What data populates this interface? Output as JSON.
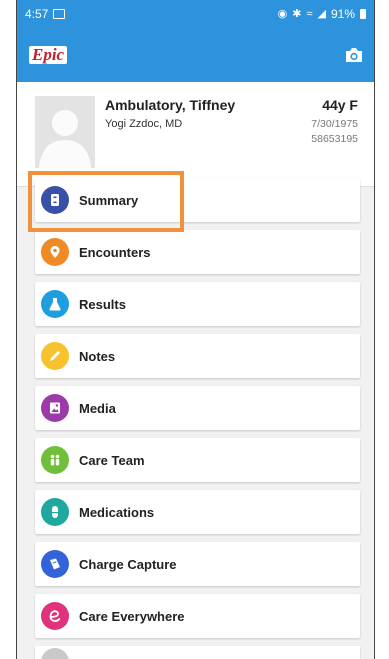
{
  "status_bar": {
    "time": "4:57",
    "battery": "91%"
  },
  "app": {
    "logo": "Epic"
  },
  "patient": {
    "name": "Ambulatory, Tiffney",
    "provider": "Yogi Zzdoc, MD",
    "age_sex": "44y F",
    "dob": "7/30/1975",
    "mrn": "58653195"
  },
  "menu": [
    {
      "label": "Summary",
      "icon": "summary-icon",
      "color": "#3a4fa8"
    },
    {
      "label": "Encounters",
      "icon": "encounters-icon",
      "color": "#f08a24"
    },
    {
      "label": "Results",
      "icon": "results-flask-icon",
      "color": "#1e9ee0"
    },
    {
      "label": "Notes",
      "icon": "notes-pencil-icon",
      "color": "#f7c22e"
    },
    {
      "label": "Media",
      "icon": "media-icon",
      "color": "#9b3aa8"
    },
    {
      "label": "Care Team",
      "icon": "care-team-icon",
      "color": "#6fbf3a"
    },
    {
      "label": "Medications",
      "icon": "medications-pill-icon",
      "color": "#1fa7a0"
    },
    {
      "label": "Charge Capture",
      "icon": "charge-capture-icon",
      "color": "#3363d8"
    },
    {
      "label": "Care Everywhere",
      "icon": "care-everywhere-icon",
      "color": "#e0337d"
    }
  ],
  "highlight_color": "#f0913c"
}
